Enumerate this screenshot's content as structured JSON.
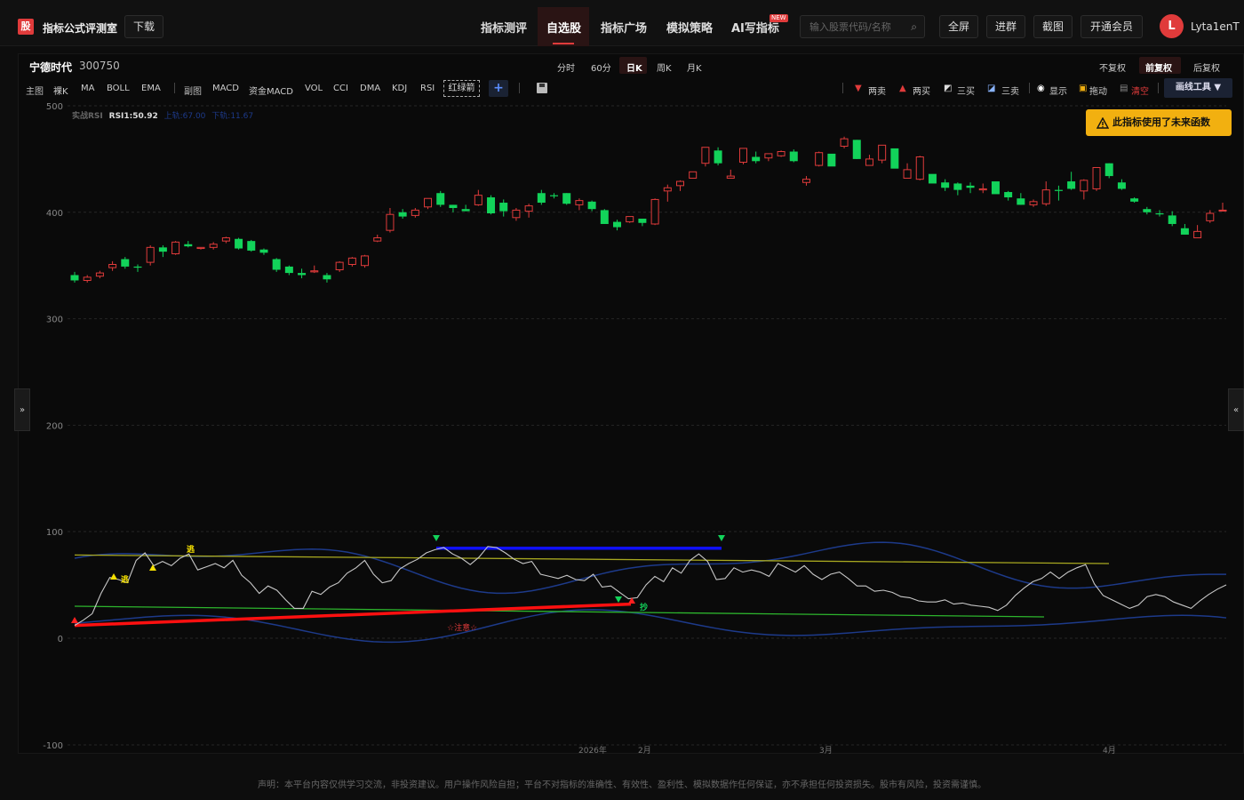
{
  "app": {
    "logo": "股",
    "title": "指标公式评测室",
    "download": "下载"
  },
  "nav": {
    "items": [
      "指标测评",
      "自选股",
      "指标广场",
      "模拟策略",
      "AI写指标"
    ],
    "active": "自选股",
    "new_badge": "NEW"
  },
  "search": {
    "placeholder": "输入股票代码/名称"
  },
  "top_buttons": {
    "fullscreen": "全屏",
    "join_group": "进群",
    "screenshot": "截图",
    "membership": "开通会员"
  },
  "user": {
    "avatar_letter": "L",
    "name": "Lyta1enT"
  },
  "stock": {
    "name": "宁德时代",
    "code": "300750"
  },
  "periods": {
    "items": [
      "分时",
      "60分",
      "日K",
      "周K",
      "月K"
    ],
    "active": "日K"
  },
  "adjust": {
    "items": [
      "不复权",
      "前复权",
      "后复权"
    ],
    "active": "前复权"
  },
  "indicators": {
    "main_label": "主图",
    "main": [
      "裸K",
      "MA",
      "BOLL",
      "EMA"
    ],
    "sub_label": "副图",
    "sub": [
      "MACD",
      "资金MACD",
      "VOL",
      "CCI",
      "DMA",
      "KDJ",
      "RSI"
    ],
    "custom": "红绿箭",
    "add": "+"
  },
  "right_tools": {
    "two_sell": "两卖",
    "two_buy": "两买",
    "three_buy": "三买",
    "three_sell": "三卖",
    "show": "显示",
    "drag": "拖动",
    "clear": "清空",
    "drawing_tools": "画线工具 ▼"
  },
  "warning": "此指标使用了未来函数",
  "rsi_legend": {
    "name": "实战RSI",
    "rsi": "RSI1:50.92",
    "upper": "上轨:67.00",
    "lower": "下轨:11.67"
  },
  "annotations": {
    "escape": "逃",
    "buy": "抄",
    "caution": "☆注意☆"
  },
  "x_labels": [
    "2026年",
    "2月",
    "3月",
    "4月"
  ],
  "colors": {
    "up": "#e03b3b",
    "down": "#12d35a",
    "rsi": "#c8c8c8",
    "band": "#1d3a8a",
    "yellow": "#a8a820",
    "green": "#2db52d",
    "accent": "#e03b3b"
  },
  "disclaimer": "声明：本平台内容仅供学习交流，非投资建议。用户操作风险自担；平台不对指标的准确性、有效性、盈利性、模拟数据作任何保证，亦不承担任何投资损失。股市有风险，投资需谨慎。",
  "chart_data": [
    {
      "type": "candlestick",
      "title": "宁德时代 300750 日K 前复权",
      "yticks": [
        500,
        400,
        300,
        200
      ],
      "ylim": [
        140,
        500
      ],
      "x_labels": [
        "2026年",
        "2月",
        "3月",
        "4月"
      ],
      "candles": [
        [
          341,
          336,
          344,
          334
        ],
        [
          336,
          339,
          341,
          334
        ],
        [
          340,
          343,
          345,
          338
        ],
        [
          348,
          351,
          354,
          345
        ],
        [
          356,
          349,
          358,
          347
        ],
        [
          349,
          348,
          351,
          344
        ],
        [
          353,
          367,
          369,
          350
        ],
        [
          367,
          363,
          369,
          358
        ],
        [
          361,
          372,
          373,
          360
        ],
        [
          370,
          368,
          373,
          367
        ],
        [
          366,
          367,
          367,
          365
        ],
        [
          367,
          370,
          372,
          365
        ],
        [
          373,
          376,
          377,
          371
        ],
        [
          375,
          366,
          376,
          365
        ],
        [
          373,
          364,
          374,
          363
        ],
        [
          365,
          362,
          366,
          360
        ],
        [
          356,
          346,
          357,
          344
        ],
        [
          349,
          343,
          350,
          341
        ],
        [
          343,
          341,
          347,
          338
        ],
        [
          344,
          345,
          350,
          343
        ],
        [
          341,
          337,
          343,
          334
        ],
        [
          346,
          353,
          354,
          344
        ],
        [
          351,
          357,
          358,
          349
        ],
        [
          350,
          359,
          360,
          348
        ],
        [
          373,
          376,
          379,
          372
        ],
        [
          383,
          398,
          404,
          381
        ],
        [
          400,
          396,
          403,
          394
        ],
        [
          397,
          402,
          404,
          395
        ],
        [
          405,
          413,
          413,
          403
        ],
        [
          418,
          407,
          420,
          405
        ],
        [
          407,
          404,
          407,
          400
        ],
        [
          403,
          401,
          407,
          401
        ],
        [
          407,
          416,
          421,
          406
        ],
        [
          414,
          399,
          416,
          398
        ],
        [
          409,
          401,
          412,
          396
        ],
        [
          395,
          402,
          404,
          392
        ],
        [
          401,
          406,
          408,
          395
        ],
        [
          418,
          409,
          421,
          407
        ],
        [
          416,
          415,
          418,
          413
        ],
        [
          418,
          408,
          418,
          407
        ],
        [
          407,
          411,
          413,
          402
        ],
        [
          410,
          403,
          411,
          401
        ],
        [
          402,
          389,
          403,
          389
        ],
        [
          391,
          386,
          393,
          383
        ],
        [
          391,
          396,
          396,
          390
        ],
        [
          394,
          390,
          394,
          387
        ],
        [
          389,
          412,
          413,
          388
        ],
        [
          420,
          423,
          426,
          410
        ],
        [
          425,
          429,
          430,
          420
        ],
        [
          432,
          438,
          438,
          432
        ],
        [
          446,
          461,
          461,
          443
        ],
        [
          458,
          446,
          461,
          444
        ],
        [
          432,
          434,
          440,
          434
        ],
        [
          447,
          460,
          460,
          445
        ],
        [
          452,
          448,
          457,
          446
        ],
        [
          451,
          455,
          455,
          448
        ],
        [
          453,
          457,
          458,
          452
        ],
        [
          457,
          448,
          459,
          447
        ],
        [
          428,
          431,
          434,
          425
        ],
        [
          444,
          456,
          457,
          443
        ],
        [
          455,
          443,
          454,
          444
        ],
        [
          462,
          469,
          471,
          460
        ],
        [
          468,
          450,
          468,
          450
        ],
        [
          444,
          450,
          454,
          444
        ],
        [
          449,
          463,
          462,
          446
        ],
        [
          460,
          441,
          459,
          442
        ],
        [
          432,
          440,
          446,
          432
        ],
        [
          431,
          452,
          453,
          430
        ],
        [
          436,
          427,
          434,
          428
        ],
        [
          428,
          423,
          431,
          420
        ],
        [
          427,
          421,
          428,
          416
        ],
        [
          425,
          423,
          428,
          418
        ],
        [
          421,
          422,
          427,
          418
        ],
        [
          429,
          417,
          425,
          418
        ],
        [
          419,
          414,
          420,
          411
        ],
        [
          413,
          407,
          418,
          407
        ],
        [
          407,
          410,
          412,
          405
        ],
        [
          408,
          421,
          429,
          406
        ],
        [
          421,
          420,
          425,
          411
        ],
        [
          429,
          422,
          438,
          421
        ],
        [
          420,
          430,
          431,
          412
        ],
        [
          422,
          442,
          440,
          420
        ],
        [
          446,
          434,
          446,
          432
        ],
        [
          428,
          422,
          431,
          421
        ],
        [
          413,
          410,
          414,
          409
        ],
        [
          403,
          400,
          405,
          398
        ],
        [
          399,
          398,
          402,
          396
        ],
        [
          397,
          389,
          401,
          387
        ],
        [
          385,
          379,
          389,
          379
        ],
        [
          376,
          382,
          388,
          376
        ],
        [
          392,
          399,
          402,
          390
        ],
        [
          402,
          402,
          409,
          401
        ]
      ]
    },
    {
      "type": "line",
      "title": "实战RSI",
      "yticks": [
        100,
        0,
        -100
      ],
      "ylim": [
        -100,
        100
      ],
      "series": [
        {
          "name": "RSI1",
          "values": [
            12,
            17,
            23,
            42,
            57,
            55,
            52,
            73,
            80,
            68,
            72,
            68,
            75,
            79,
            64,
            67,
            70,
            66,
            73,
            59,
            52,
            42,
            49,
            45,
            36,
            28,
            28,
            44,
            41,
            48,
            52,
            61,
            66,
            73,
            60,
            52,
            54,
            65,
            70,
            74,
            80,
            83,
            85,
            79,
            75,
            69,
            76,
            86,
            85,
            80,
            74,
            70,
            72,
            60,
            58,
            56,
            59,
            55,
            54,
            60,
            48,
            49,
            43,
            37,
            38,
            50,
            58,
            53,
            66,
            61,
            73,
            79,
            72,
            55,
            56,
            66,
            62,
            64,
            62,
            58,
            70,
            66,
            62,
            68,
            60,
            55,
            60,
            62,
            56,
            49,
            49,
            44,
            45,
            43,
            39,
            38,
            35,
            34,
            34,
            36,
            32,
            33,
            31,
            30,
            29,
            26,
            31,
            40,
            47,
            53,
            56,
            62,
            56,
            62,
            66,
            69,
            51,
            40,
            36,
            32,
            28,
            31,
            39,
            41,
            39,
            34,
            31,
            28,
            35,
            41,
            46,
            50
          ]
        }
      ],
      "bands": {
        "upper_value": 67.0,
        "lower_value": 11.67
      },
      "trendlines": [
        {
          "color": "yellow",
          "from": 78,
          "to": 70
        },
        {
          "color": "green",
          "from": 30,
          "to": 20
        },
        {
          "color": "red",
          "from": 12,
          "to": 32
        },
        {
          "color": "blue",
          "from": 86,
          "to": 86
        }
      ]
    }
  ]
}
